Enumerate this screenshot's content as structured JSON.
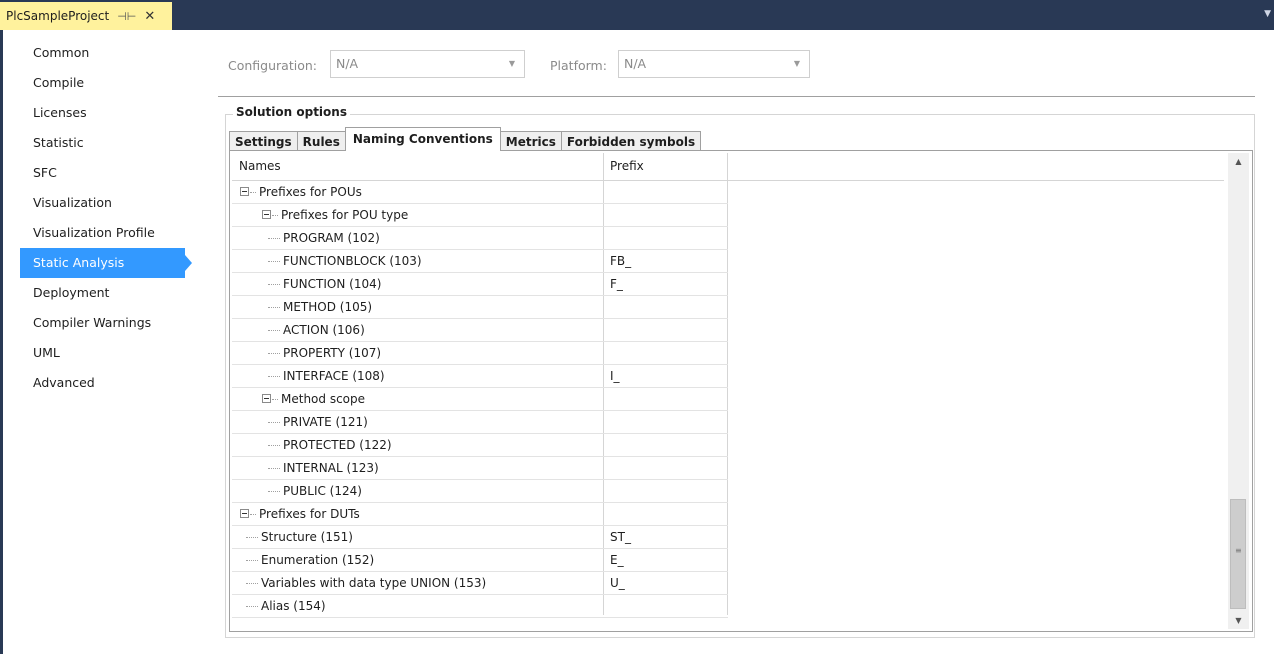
{
  "document_tab": {
    "title": "PlcSampleProject",
    "pin_icon": "pin-icon",
    "close_icon": "close-icon"
  },
  "categories": [
    {
      "label": "Common"
    },
    {
      "label": "Compile"
    },
    {
      "label": "Licenses"
    },
    {
      "label": "Statistic"
    },
    {
      "label": "SFC"
    },
    {
      "label": "Visualization"
    },
    {
      "label": "Visualization Profile"
    },
    {
      "label": "Static Analysis",
      "selected": true
    },
    {
      "label": "Deployment"
    },
    {
      "label": "Compiler Warnings"
    },
    {
      "label": "UML"
    },
    {
      "label": "Advanced"
    }
  ],
  "configuration": {
    "label": "Configuration:",
    "value": "N/A"
  },
  "platform": {
    "label": "Platform:",
    "value": "N/A"
  },
  "group_title": "Solution options",
  "tabs": [
    {
      "label": "Settings"
    },
    {
      "label": "Rules"
    },
    {
      "label": "Naming Conventions",
      "active": true
    },
    {
      "label": "Metrics"
    },
    {
      "label": "Forbidden symbols"
    }
  ],
  "grid": {
    "columns": {
      "names": "Names",
      "prefix": "Prefix"
    },
    "rows": [
      {
        "name": "Prefixes for POUs",
        "prefix": ""
      },
      {
        "name": "Prefixes for POU type",
        "prefix": ""
      },
      {
        "name": "PROGRAM (102)",
        "prefix": ""
      },
      {
        "name": "FUNCTIONBLOCK (103)",
        "prefix": "FB_"
      },
      {
        "name": "FUNCTION (104)",
        "prefix": "F_"
      },
      {
        "name": "METHOD (105)",
        "prefix": ""
      },
      {
        "name": "ACTION (106)",
        "prefix": ""
      },
      {
        "name": "PROPERTY (107)",
        "prefix": ""
      },
      {
        "name": "INTERFACE (108)",
        "prefix": "I_"
      },
      {
        "name": "Method scope",
        "prefix": ""
      },
      {
        "name": "PRIVATE (121)",
        "prefix": ""
      },
      {
        "name": "PROTECTED (122)",
        "prefix": ""
      },
      {
        "name": "INTERNAL (123)",
        "prefix": ""
      },
      {
        "name": "PUBLIC (124)",
        "prefix": ""
      },
      {
        "name": "Prefixes for DUTs",
        "prefix": ""
      },
      {
        "name": "Structure (151)",
        "prefix": "ST_"
      },
      {
        "name": "Enumeration (152)",
        "prefix": "E_"
      },
      {
        "name": "Variables with data type UNION (153)",
        "prefix": "U_"
      },
      {
        "name": "Alias (154)",
        "prefix": ""
      }
    ]
  },
  "colors": {
    "title_bar": "#293955",
    "active_doc_tab": "#fff29d",
    "selection": "#3399ff"
  }
}
